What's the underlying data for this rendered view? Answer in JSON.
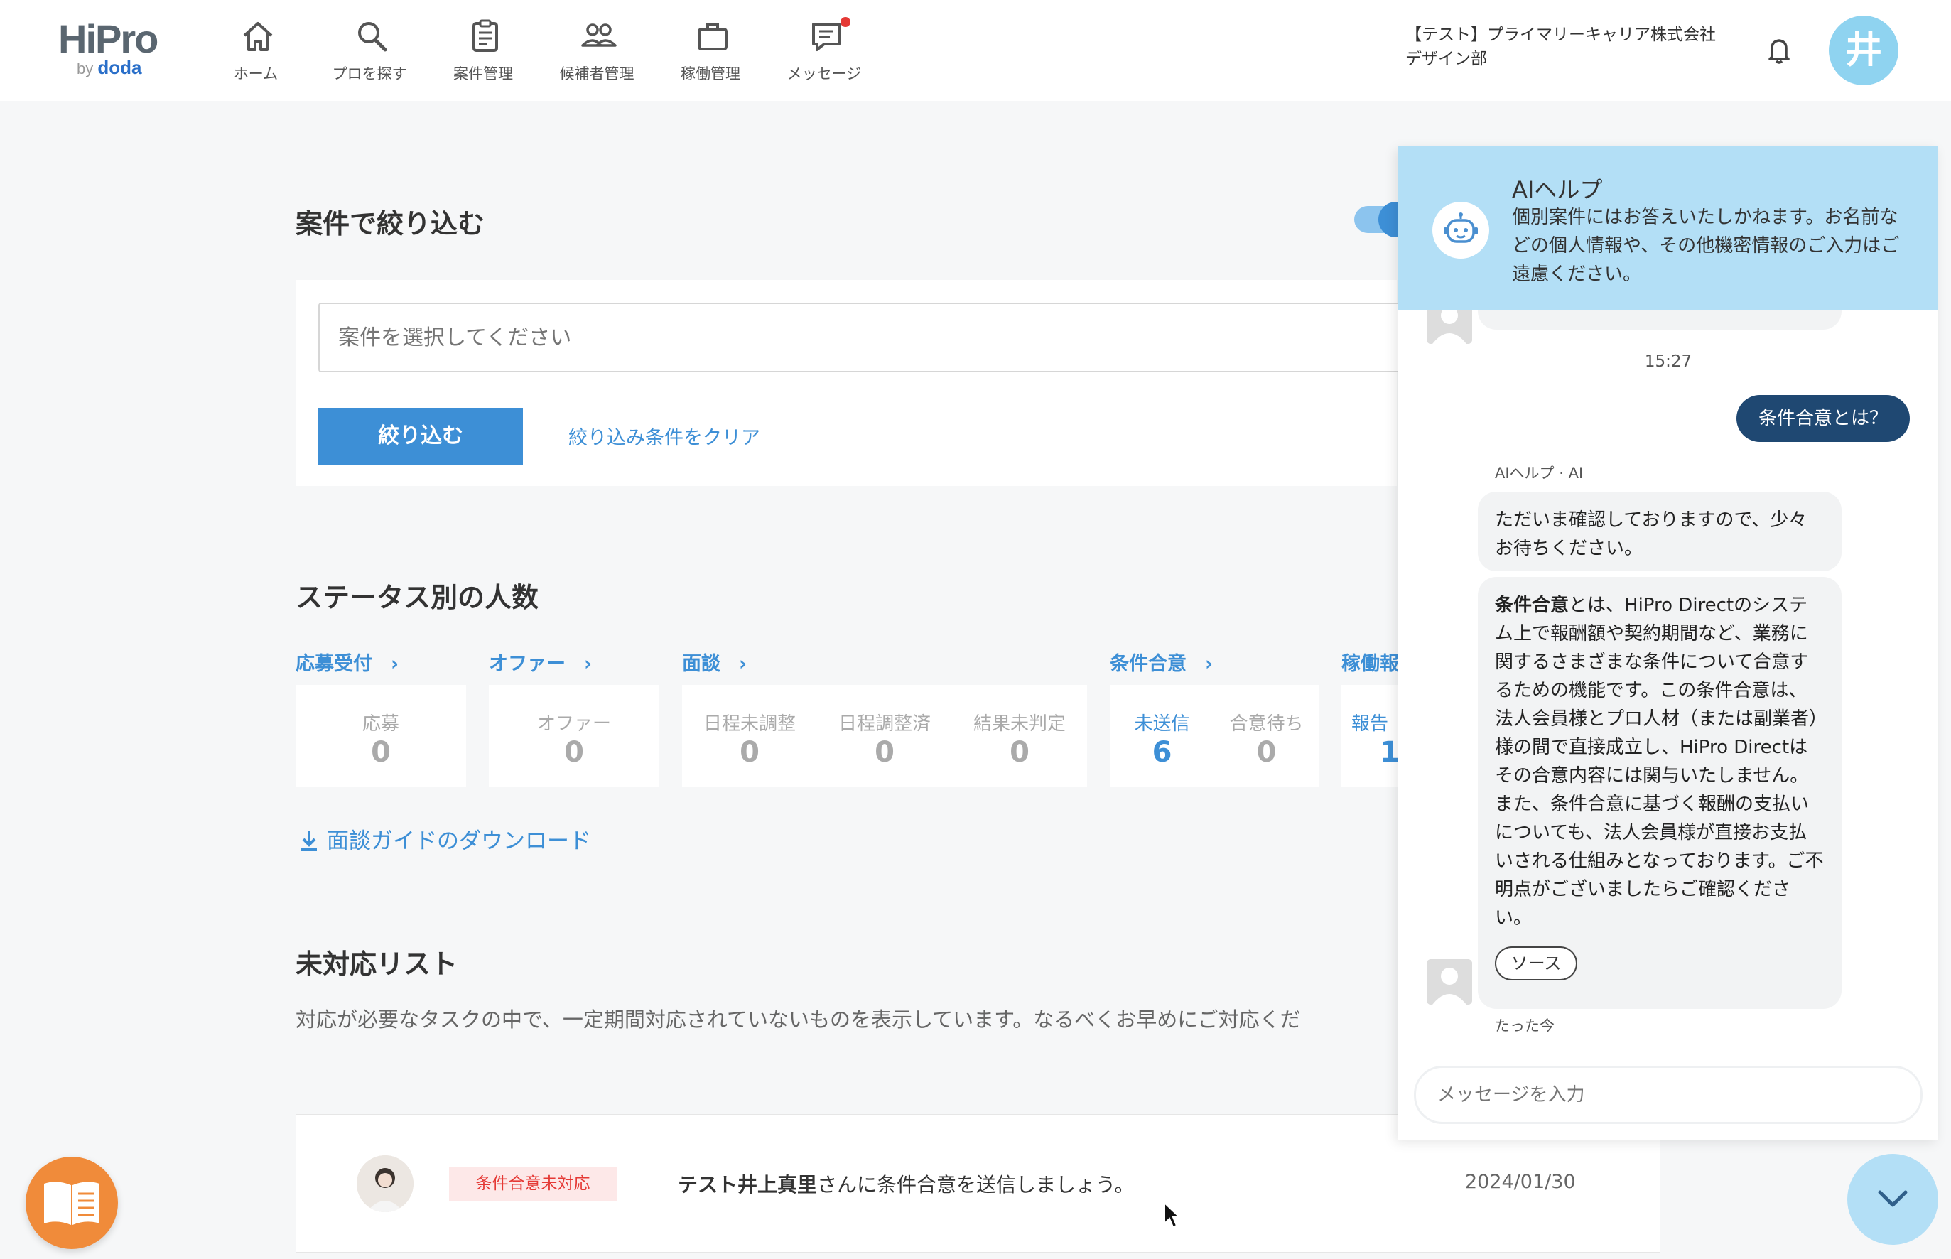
{
  "header": {
    "logo_main": "HiPro",
    "logo_by": "by",
    "logo_brand": "doda",
    "nav": [
      {
        "label": "ホーム",
        "icon": "home-icon"
      },
      {
        "label": "プロを探す",
        "icon": "search-icon"
      },
      {
        "label": "案件管理",
        "icon": "clipboard-icon"
      },
      {
        "label": "候補者管理",
        "icon": "people-icon"
      },
      {
        "label": "稼働管理",
        "icon": "briefcase-icon"
      },
      {
        "label": "メッセージ",
        "icon": "message-icon"
      }
    ],
    "company_line1": "【テスト】プライマリーキャリア株式会社",
    "company_line2": "デザイン部",
    "user_initial": "井"
  },
  "filter": {
    "title": "案件で絞り込む",
    "placeholder": "案件を選択してください",
    "submit_label": "絞り込む",
    "clear_label": "絞り込み条件をクリア"
  },
  "status": {
    "title": "ステータス別の人数",
    "groups": [
      {
        "label": "応募受付",
        "cells": [
          {
            "label": "応募",
            "value": "0"
          }
        ]
      },
      {
        "label": "オファー",
        "cells": [
          {
            "label": "オファー",
            "value": "0"
          }
        ]
      },
      {
        "label": "面談",
        "cells": [
          {
            "label": "日程未調整",
            "value": "0"
          },
          {
            "label": "日程調整済",
            "value": "0"
          },
          {
            "label": "結果未判定",
            "value": "0"
          }
        ]
      },
      {
        "label": "条件合意",
        "cells": [
          {
            "label": "未送信",
            "value": "6"
          },
          {
            "label": "合意待ち",
            "value": "0"
          }
        ]
      },
      {
        "label": "稼働報",
        "cells": [
          {
            "label": "報告",
            "value": "1"
          }
        ]
      }
    ],
    "download_label": "面談ガイドのダウンロード"
  },
  "pending": {
    "title": "未対応リスト",
    "description": "対応が必要なタスクの中で、一定期間対応されていないものを表示しています。なるべくお早めにご対応くだ",
    "tasks": [
      {
        "badge": "条件合意未対応",
        "name": "テスト井上真里",
        "text": "さんに条件合意を送信しましょう。",
        "date": "2024/01/30"
      }
    ]
  },
  "chat": {
    "title": "AIヘルプ",
    "notice": "個別案件にはお答えいたしかねます。お名前などの個人情報や、その他機密情報のご入力はご遠慮ください。",
    "time": "15:27",
    "user_message": "条件合意とは？",
    "ai_meta": "AIヘルプ · AI",
    "ai_message_1": "ただいま確認しておりますので、少々お待ちください。",
    "ai_message_2_bold": "条件合意",
    "ai_message_2": "とは、HiPro Directのシステム上で報酬額や契約期間など、業務に関するさまざまな条件について合意するための機能です。この条件合意は、法人会員様とプロ人材（または副業者）様の間で直接成立し、HiPro Directはその合意内容には関与いたしません。また、条件合意に基づく報酬の支払いについても、法人会員様が直接お支払いされる仕組みとなっております。ご不明点がございましたらご確認ください。",
    "source_label": "ソース",
    "ai_time": "たった今",
    "input_placeholder": "メッセージを入力"
  },
  "colors": {
    "accent": "#3d8fd6",
    "chat_header": "#b3dff6",
    "user_bubble": "#1f4872",
    "badge_bg": "#fde8e8",
    "badge_text": "#e53935",
    "book_fab": "#f08b3a"
  }
}
